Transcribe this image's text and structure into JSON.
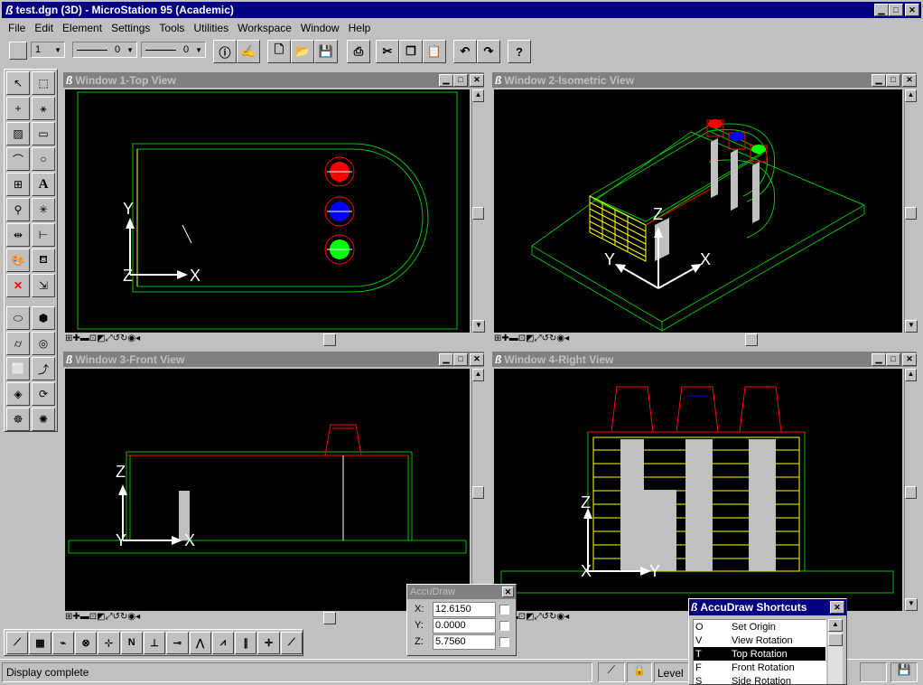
{
  "app": {
    "title": "test.dgn (3D) - MicroStation 95 (Academic)"
  },
  "menu": [
    "File",
    "Edit",
    "Element",
    "Settings",
    "Tools",
    "Utilities",
    "Workspace",
    "Window",
    "Help"
  ],
  "toolbar": {
    "level_value": "1",
    "style_value": "0",
    "weight_value": "0"
  },
  "views": [
    {
      "title": "Window 1-Top View"
    },
    {
      "title": "Window 2-Isometric View"
    },
    {
      "title": "Window 3-Front View"
    },
    {
      "title": "Window 4-Right View"
    }
  ],
  "axes": {
    "x": "X",
    "y": "Y",
    "z": "Z"
  },
  "accudraw": {
    "title": "AccuDraw",
    "x_label": "X:",
    "x_value": "12.6150",
    "y_label": "Y:",
    "y_value": "0.0000",
    "z_label": "Z:",
    "z_value": "5.7560"
  },
  "shortcuts": {
    "title": "AccuDraw Shortcuts",
    "items": [
      {
        "key": "O",
        "label": "Set Origin"
      },
      {
        "key": "V",
        "label": "View Rotation"
      },
      {
        "key": "T",
        "label": "Top Rotation",
        "selected": true
      },
      {
        "key": "F",
        "label": "Front Rotation"
      },
      {
        "key": "S",
        "label": "Side Rotation"
      }
    ]
  },
  "status": {
    "text": "Display complete",
    "level": "Level"
  },
  "colors": {
    "title_active": "#000080",
    "title_inactive": "#808080",
    "outline": "#00c000",
    "red": "#ff0000",
    "blue": "#0000ff",
    "green": "#00ff00",
    "yellow": "#ffff00"
  }
}
